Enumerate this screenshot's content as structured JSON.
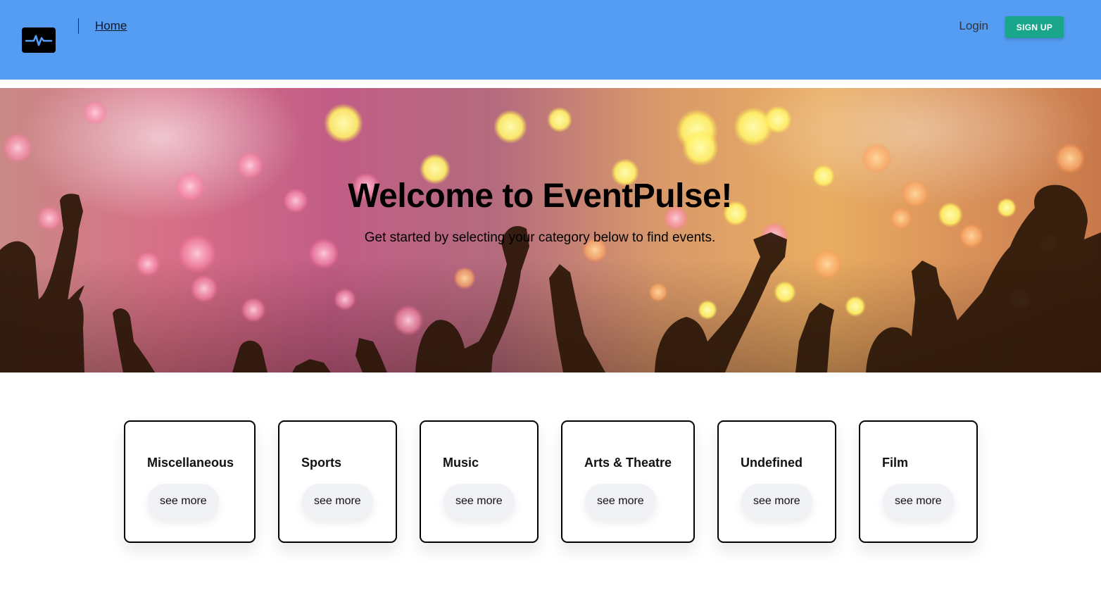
{
  "header": {
    "logo_icon": "pulse-icon",
    "nav_home": "Home",
    "nav_login": "Login",
    "signup_label": "SIGN UP",
    "background_color": "#559cf3",
    "signup_color": "#1aa68b"
  },
  "hero": {
    "title": "Welcome to EventPulse!",
    "subtitle": "Get started by selecting your category below to find events."
  },
  "categories": [
    {
      "title": "Miscellaneous",
      "button": "see more"
    },
    {
      "title": "Sports",
      "button": "see more"
    },
    {
      "title": "Music",
      "button": "see more"
    },
    {
      "title": "Arts & Theatre",
      "button": "see more"
    },
    {
      "title": "Undefined",
      "button": "see more"
    },
    {
      "title": "Film",
      "button": "see more"
    }
  ]
}
